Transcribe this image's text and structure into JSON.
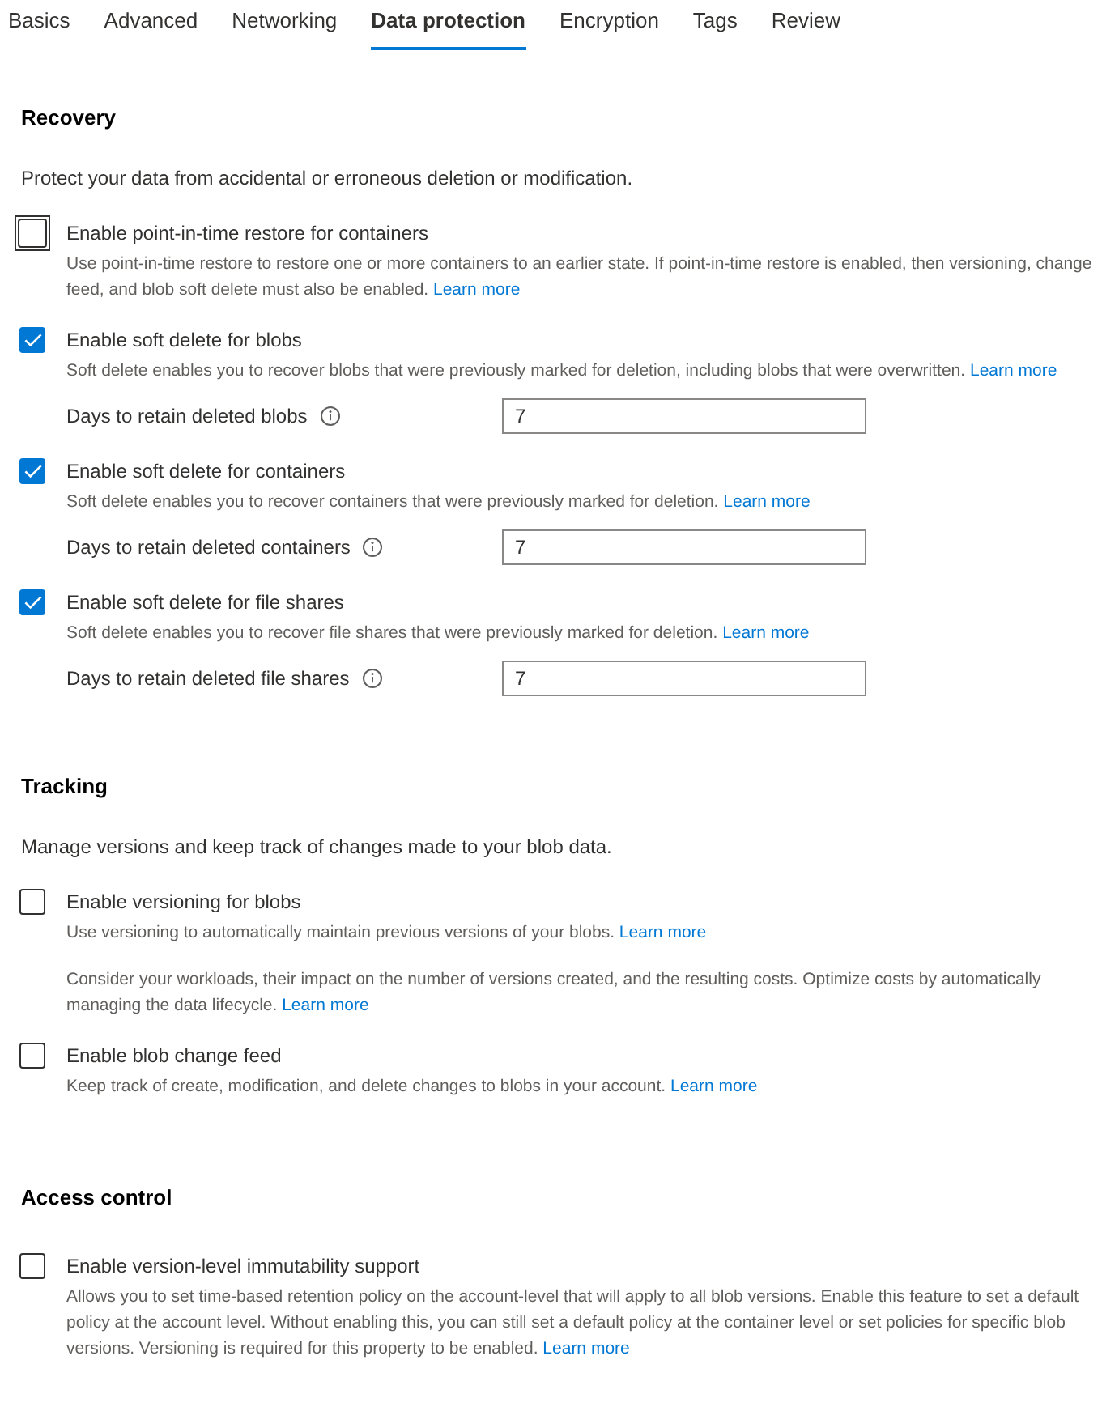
{
  "tabs": [
    {
      "label": "Basics",
      "selected": false
    },
    {
      "label": "Advanced",
      "selected": false
    },
    {
      "label": "Networking",
      "selected": false
    },
    {
      "label": "Data protection",
      "selected": true
    },
    {
      "label": "Encryption",
      "selected": false
    },
    {
      "label": "Tags",
      "selected": false
    },
    {
      "label": "Review",
      "selected": false
    }
  ],
  "sections": [
    {
      "title": "Recovery",
      "description": "Protect your data from accidental or erroneous deletion or modification.",
      "items": [
        {
          "kind": "checkbox",
          "label": "Enable point-in-time restore for containers",
          "checked": false,
          "focused": true,
          "help": "Use point-in-time restore to restore one or more containers to an earlier state. If point-in-time restore is enabled, then versioning, change feed, and blob soft delete must also be enabled.",
          "link": "Learn more"
        },
        {
          "kind": "checkbox",
          "label": "Enable soft delete for blobs",
          "checked": true,
          "focused": false,
          "help": "Soft delete enables you to recover blobs that were previously marked for deletion, including blobs that were overwritten.",
          "link": "Learn more"
        },
        {
          "kind": "field",
          "label": "Days to retain deleted blobs",
          "value": "7"
        },
        {
          "kind": "checkbox",
          "label": "Enable soft delete for containers",
          "checked": true,
          "focused": false,
          "help": "Soft delete enables you to recover containers that were previously marked for deletion.",
          "link": "Learn more"
        },
        {
          "kind": "field",
          "label": "Days to retain deleted containers",
          "value": "7"
        },
        {
          "kind": "checkbox",
          "label": "Enable soft delete for file shares",
          "checked": true,
          "focused": false,
          "help": "Soft delete enables you to recover file shares that were previously marked for deletion.",
          "link": "Learn more"
        },
        {
          "kind": "field",
          "label": "Days to retain deleted file shares",
          "value": "7"
        }
      ]
    },
    {
      "title": "Tracking",
      "description": "Manage versions and keep track of changes made to your blob data.",
      "items": [
        {
          "kind": "checkbox",
          "label": "Enable versioning for blobs",
          "checked": false,
          "focused": false,
          "help": "Use versioning to automatically maintain previous versions of your blobs.",
          "link": "Learn more"
        },
        {
          "kind": "note",
          "text": "Consider your workloads, their impact on the number of versions created, and the resulting costs. Optimize costs by automatically managing the data lifecycle.",
          "link": "Learn more"
        },
        {
          "kind": "checkbox",
          "label": "Enable blob change feed",
          "checked": false,
          "focused": false,
          "help": "Keep track of create, modification, and delete changes to blobs in your account.",
          "link": "Learn more"
        }
      ]
    },
    {
      "title": "Access control",
      "items": [
        {
          "kind": "checkbox",
          "label": "Enable version-level immutability support",
          "checked": false,
          "focused": false,
          "help": "Allows you to set time-based retention policy on the account-level that will apply to all blob versions. Enable this feature to set a default policy at the account level. Without enabling this, you can still set a default policy at the container level or set policies for specific blob versions. Versioning is required for this property to be enabled.",
          "link": "Learn more"
        }
      ]
    }
  ]
}
